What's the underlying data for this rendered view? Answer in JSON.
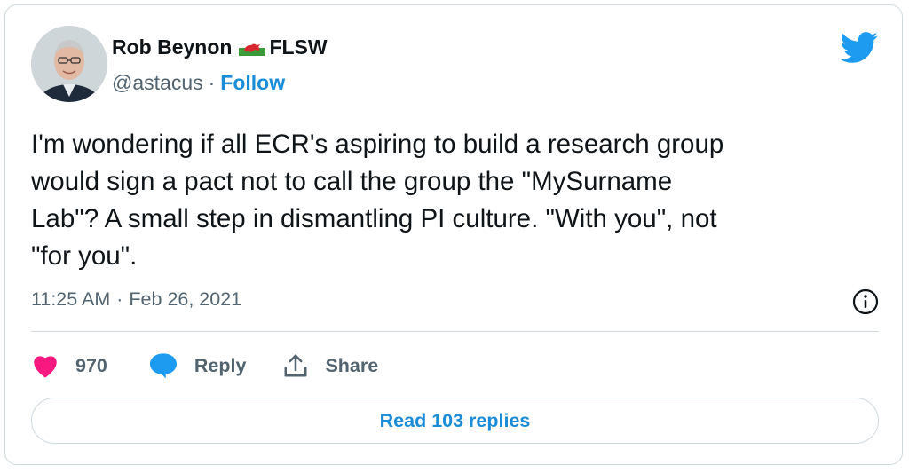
{
  "author": {
    "name": "Rob Beynon",
    "flag_icon": "wales-flag-icon",
    "affiliation": "FLSW",
    "handle": "@astacus",
    "separator": "·",
    "follow_label": "Follow"
  },
  "brand_icon": "twitter-bird-icon",
  "colors": {
    "accent": "#1d9bf0",
    "link": "#1a8cd8",
    "like": "#f91880",
    "muted": "#536471",
    "border": "#cfd9de"
  },
  "tweet": {
    "text": "I'm wondering if all ECR's aspiring to build a research group\nwould sign a pact not to call the group the \"MySurname\nLab\"? A small step in dismantling PI culture. \"With you\", not\n\"for you\".",
    "time": "11:25 AM",
    "separator": "·",
    "date": "Feb 26, 2021"
  },
  "actions": {
    "like_count": "970",
    "reply_label": "Reply",
    "share_label": "Share"
  },
  "read_replies_label": "Read 103 replies"
}
